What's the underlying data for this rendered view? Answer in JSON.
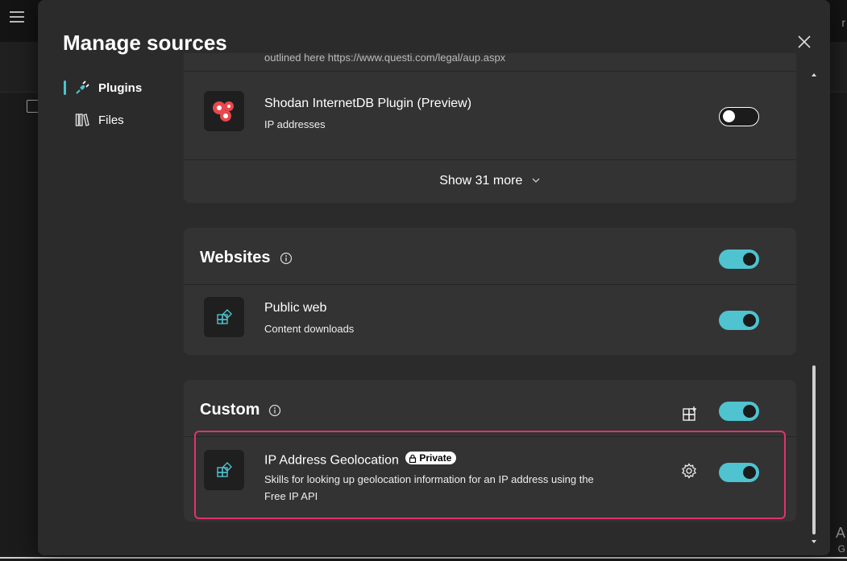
{
  "background": {
    "right_letter_1": "r",
    "right_letter_2": "A",
    "right_letter_3": "G"
  },
  "dialog": {
    "title": "Manage sources",
    "close_icon": "close-icon"
  },
  "nav": {
    "items": [
      {
        "label": "Plugins",
        "icon": "plug-icon",
        "active": true
      },
      {
        "label": "Files",
        "icon": "library-icon",
        "active": false
      }
    ]
  },
  "plugins": {
    "cut_text": "outlined here https://www.questi.com/legal/aup.aspx",
    "item": {
      "title": "Shodan InternetDB Plugin (Preview)",
      "subtitle": "IP addresses",
      "enabled": false
    },
    "show_more": "Show 31 more"
  },
  "websites": {
    "title": "Websites",
    "enabled": true,
    "item": {
      "title": "Public web",
      "subtitle": "Content downloads",
      "enabled": true
    }
  },
  "custom": {
    "title": "Custom",
    "enabled": true,
    "item": {
      "title": "IP Address Geolocation",
      "badge": "Private",
      "subtitle_line1": "Skills for looking up geolocation information for an IP address using the",
      "subtitle_line2": "Free IP API",
      "enabled": true
    }
  },
  "colors": {
    "accent": "#4fc3cf",
    "highlight": "#e0336a",
    "dialog_bg": "#2b2b2b",
    "card_bg": "#333333"
  }
}
